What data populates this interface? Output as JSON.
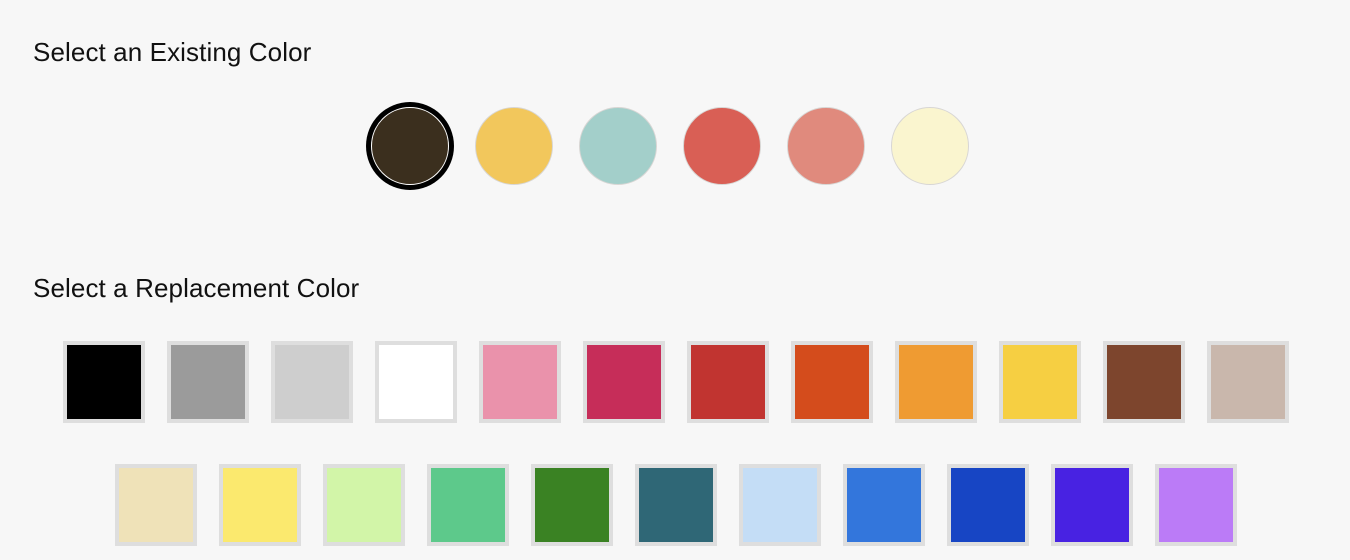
{
  "headings": {
    "existing": "Select an Existing Color",
    "replacement": "Select a Replacement Color"
  },
  "existing_colors": {
    "selected_index": 0,
    "swatches": [
      {
        "name": "dark-brown",
        "hex": "#3B2F1E"
      },
      {
        "name": "golden-yellow",
        "hex": "#F2C75C"
      },
      {
        "name": "pale-teal",
        "hex": "#A3CFCA"
      },
      {
        "name": "brick-red",
        "hex": "#D95F55"
      },
      {
        "name": "salmon-pink",
        "hex": "#E08A7D"
      },
      {
        "name": "pale-cream",
        "hex": "#FAF5CF"
      }
    ]
  },
  "replacement_colors": {
    "rows": [
      [
        {
          "name": "black",
          "hex": "#000000"
        },
        {
          "name": "gray",
          "hex": "#9B9B9B"
        },
        {
          "name": "light-gray",
          "hex": "#CECECE"
        },
        {
          "name": "white",
          "hex": "#FFFFFF"
        },
        {
          "name": "pink",
          "hex": "#EA92AB"
        },
        {
          "name": "crimson",
          "hex": "#C62D59"
        },
        {
          "name": "red",
          "hex": "#C13430"
        },
        {
          "name": "orange-red",
          "hex": "#D44C1C"
        },
        {
          "name": "orange",
          "hex": "#EF9B32"
        },
        {
          "name": "yellow",
          "hex": "#F6CF42"
        },
        {
          "name": "brown",
          "hex": "#7D452D"
        },
        {
          "name": "taupe",
          "hex": "#C9B7AC"
        }
      ],
      [
        {
          "name": "beige",
          "hex": "#EFE2B8"
        },
        {
          "name": "light-yellow",
          "hex": "#FBE96E"
        },
        {
          "name": "light-green",
          "hex": "#D2F5A8"
        },
        {
          "name": "mint-green",
          "hex": "#5DC98B"
        },
        {
          "name": "forest-green",
          "hex": "#3A8223"
        },
        {
          "name": "teal",
          "hex": "#2F6776"
        },
        {
          "name": "light-blue",
          "hex": "#C4DDF6"
        },
        {
          "name": "blue",
          "hex": "#3376DC"
        },
        {
          "name": "dark-blue",
          "hex": "#1745C4"
        },
        {
          "name": "indigo",
          "hex": "#4822E2"
        },
        {
          "name": "violet",
          "hex": "#BB7BF7"
        }
      ]
    ]
  }
}
